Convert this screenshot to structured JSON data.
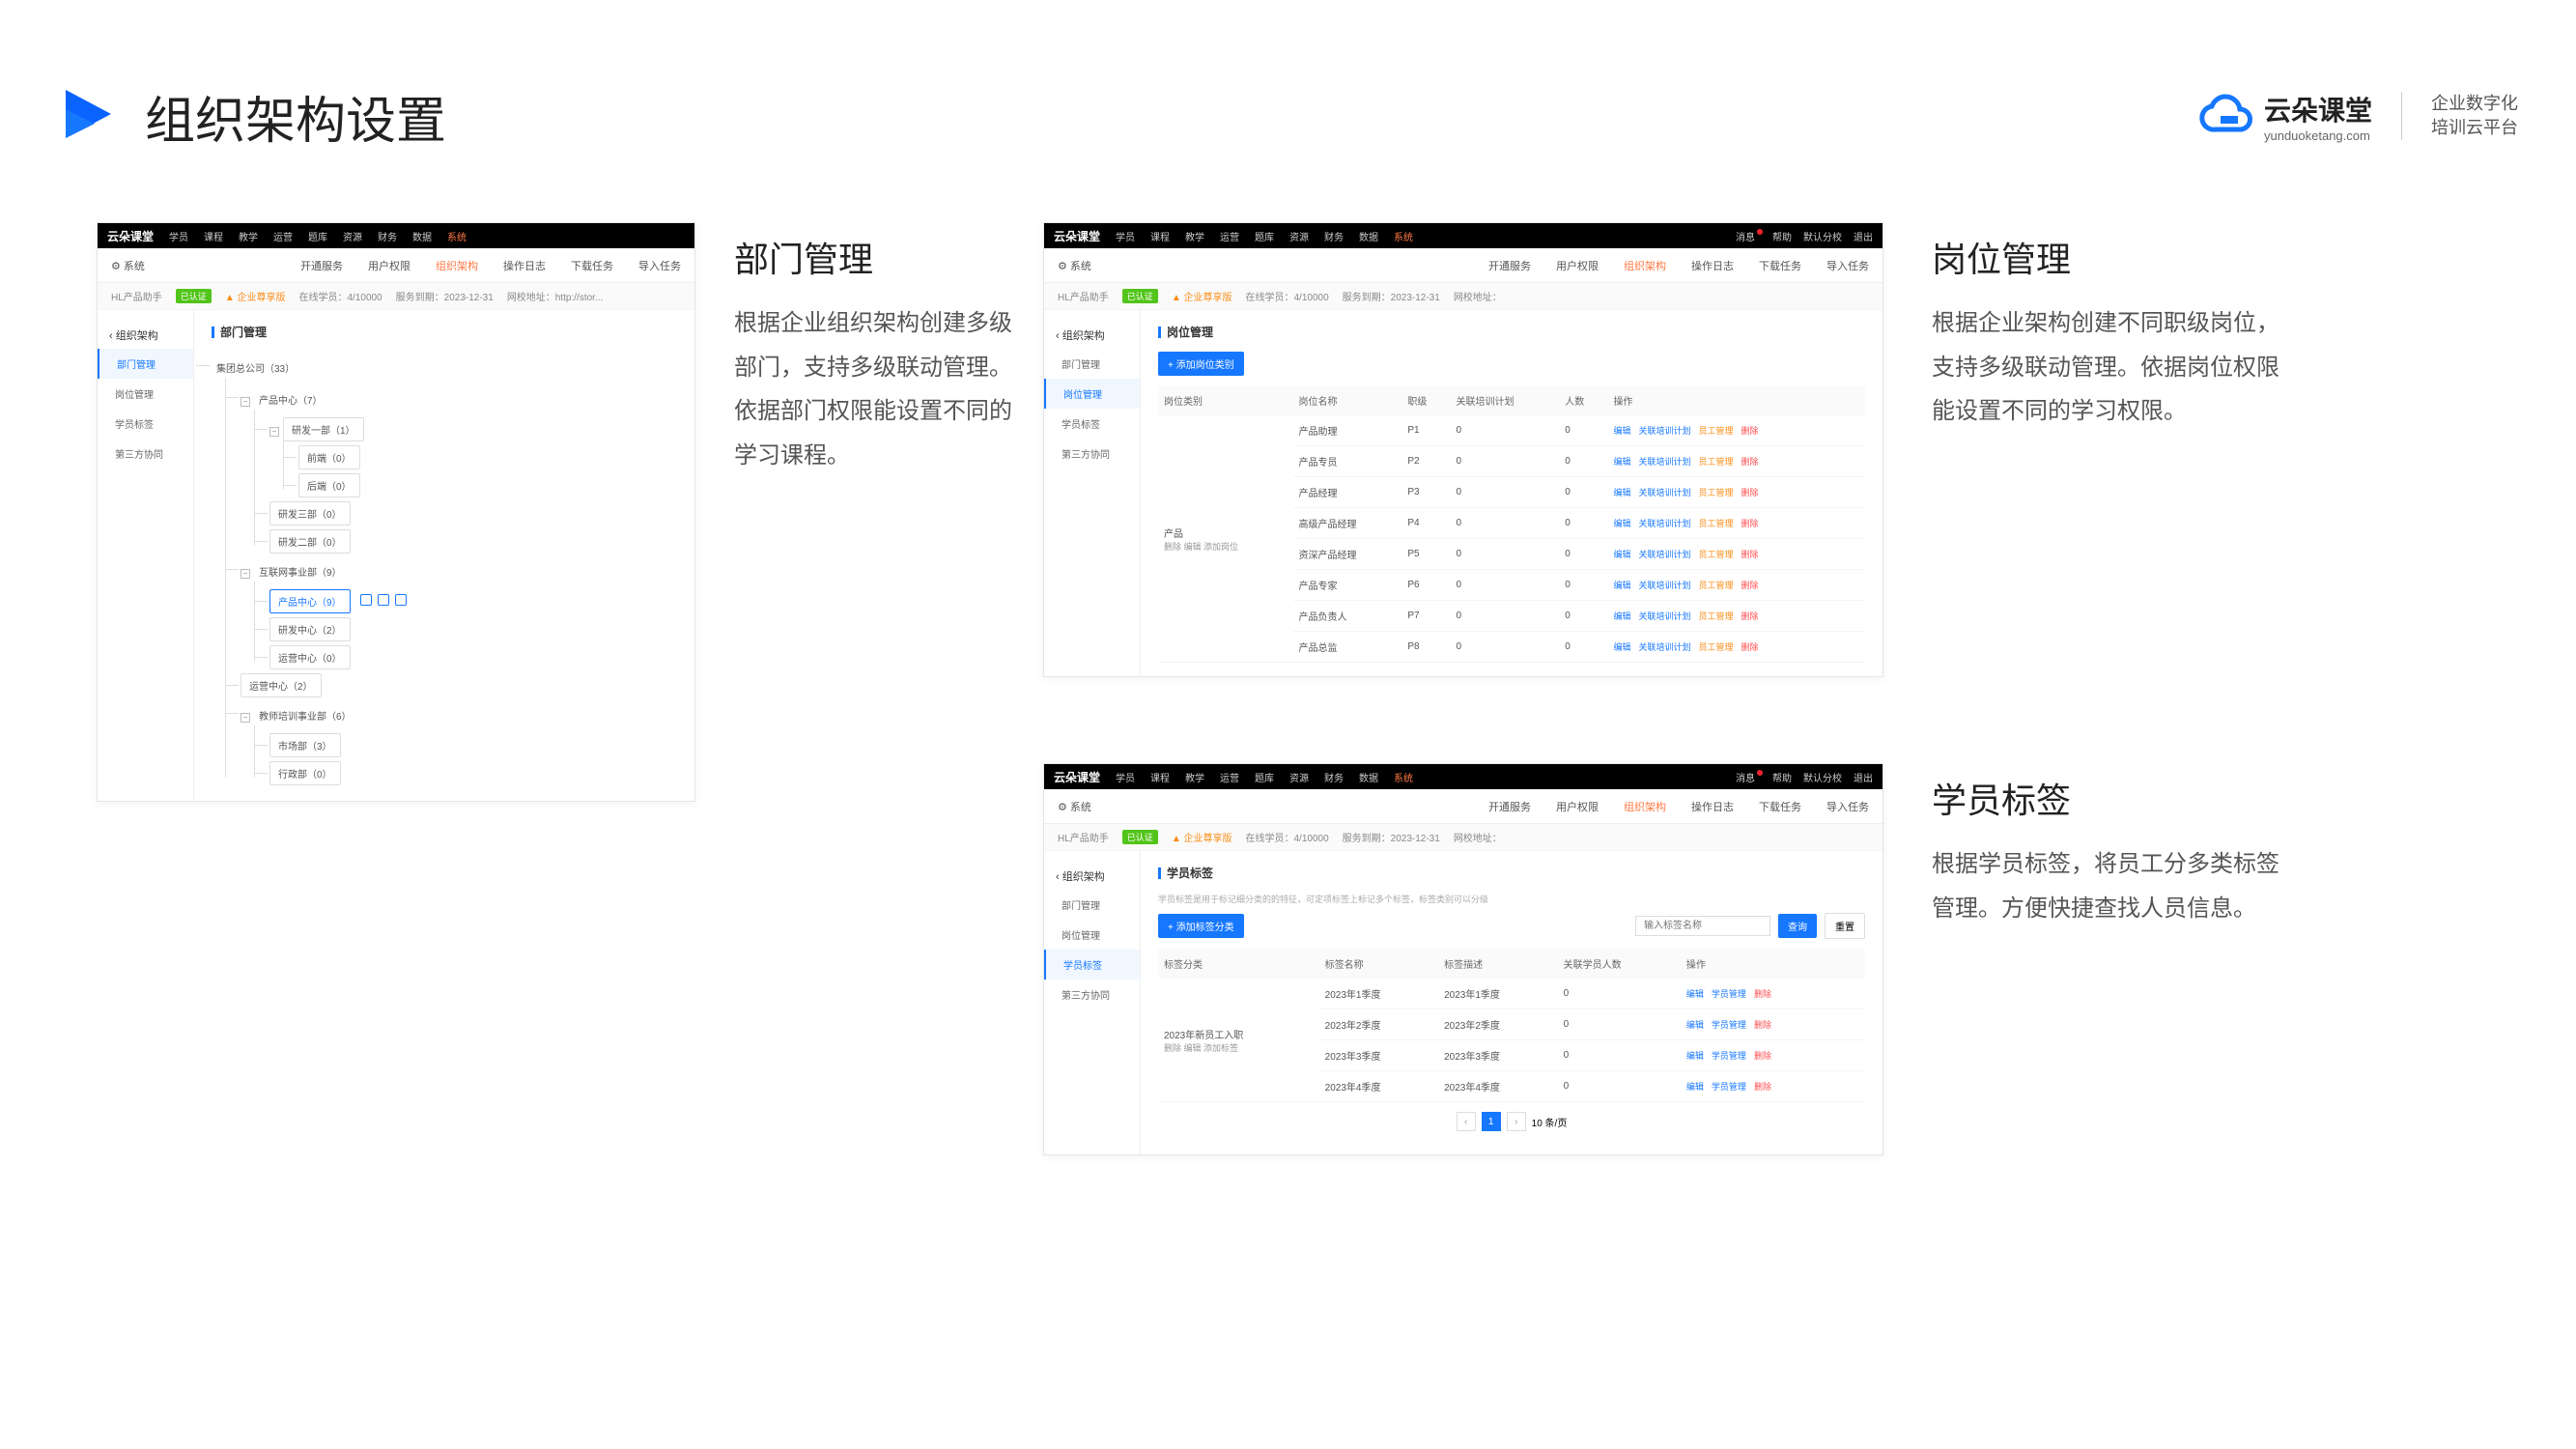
{
  "header": {
    "title": "组织架构设置",
    "logo_cn": "云朵课堂",
    "logo_en": "yunduoketang.com",
    "tagline_line1": "企业数字化",
    "tagline_line2": "培训云平台"
  },
  "sections": {
    "dept": {
      "title": "部门管理",
      "desc": "根据企业组织架构创建多级部门，支持多级联动管理。依据部门权限能设置不同的学习课程。"
    },
    "position": {
      "title": "岗位管理",
      "desc": "根据企业架构创建不同职级岗位，支持多级联动管理。依据岗位权限能设置不同的学习权限。"
    },
    "tag": {
      "title": "学员标签",
      "desc": "根据学员标签，将员工分多类标签管理。方便快捷查找人员信息。"
    }
  },
  "app_common": {
    "brand": "云朵课堂",
    "top_nav": [
      "学员",
      "课程",
      "教学",
      "运营",
      "题库",
      "资源",
      "财务",
      "数据",
      "系统"
    ],
    "top_nav_active": "系统",
    "msg": "消息",
    "help": "帮助",
    "branch": "默认分校",
    "logout": "退出",
    "gear_label": "系统",
    "sub_nav": [
      "开通服务",
      "用户权限",
      "组织架构",
      "操作日志",
      "下载任务",
      "导入任务"
    ],
    "sub_nav_active": "组织架构",
    "tenant": "HL产品助手",
    "cert": "已认证",
    "plan": "企业尊享版",
    "online": "在线学员：4/10000",
    "expiry": "服务到期：2023-12-31",
    "site": "网校地址：http://stor...",
    "site_short": "网校地址：",
    "sidebar_title": "组织架构",
    "sidebar_items": [
      "部门管理",
      "岗位管理",
      "学员标签",
      "第三方协同"
    ]
  },
  "panel_dept": {
    "main_title": "部门管理",
    "tree": {
      "root": "集团总公司（33）",
      "c1": {
        "name": "产品中心（7）",
        "children": [
          {
            "name": "研发一部（1）",
            "children": [
              {
                "name": "前端（0）"
              },
              {
                "name": "后端（0）"
              }
            ]
          },
          {
            "name": "研发三部（0）"
          },
          {
            "name": "研发二部（0）"
          }
        ]
      },
      "c2": {
        "name": "互联网事业部（9）",
        "children": [
          {
            "name": "产品中心（9）",
            "selected": true,
            "icons": true
          },
          {
            "name": "研发中心（2）"
          },
          {
            "name": "运营中心（0）"
          }
        ]
      },
      "c3": {
        "name": "运营中心（2）"
      },
      "c4": {
        "name": "教师培训事业部（6）",
        "children": [
          {
            "name": "市场部（3）"
          },
          {
            "name": "行政部（0）"
          }
        ]
      }
    }
  },
  "panel_position": {
    "main_title": "岗位管理",
    "add_btn": "+ 添加岗位类别",
    "columns": [
      "岗位类别",
      "岗位名称",
      "职级",
      "关联培训计划",
      "人数",
      "操作"
    ],
    "group": {
      "name": "产品",
      "actions": "删除 编辑 添加岗位"
    },
    "rows": [
      {
        "name": "产品助理",
        "level": "P1",
        "plan": 0,
        "count": 0
      },
      {
        "name": "产品专员",
        "level": "P2",
        "plan": 0,
        "count": 0
      },
      {
        "name": "产品经理",
        "level": "P3",
        "plan": 0,
        "count": 0
      },
      {
        "name": "高级产品经理",
        "level": "P4",
        "plan": 0,
        "count": 0
      },
      {
        "name": "资深产品经理",
        "level": "P5",
        "plan": 0,
        "count": 0
      },
      {
        "name": "产品专家",
        "level": "P6",
        "plan": 0,
        "count": 0
      },
      {
        "name": "产品负责人",
        "level": "P7",
        "plan": 0,
        "count": 0
      },
      {
        "name": "产品总监",
        "level": "P8",
        "plan": 0,
        "count": 0
      }
    ],
    "row_actions": {
      "edit": "编辑",
      "plan": "关联培训计划",
      "mgr": "员工管理",
      "del": "删除"
    }
  },
  "panel_tag": {
    "main_title": "学员标签",
    "tip": "学员标签是用于标记细分类的的特征，可定项标签上标记多个标签，标签类别可以分级",
    "add_btn": "+ 添加标签分类",
    "search_placeholder": "输入标签名称",
    "search_btn": "查询",
    "reset_btn": "重置",
    "columns": [
      "标签分类",
      "标签名称",
      "标签描述",
      "关联学员人数",
      "操作"
    ],
    "group": {
      "name": "2023年新员工入职",
      "actions": "删除 编辑 添加标签"
    },
    "rows": [
      {
        "name": "2023年1季度",
        "desc": "2023年1季度",
        "count": 0
      },
      {
        "name": "2023年2季度",
        "desc": "2023年2季度",
        "count": 0
      },
      {
        "name": "2023年3季度",
        "desc": "2023年3季度",
        "count": 0
      },
      {
        "name": "2023年4季度",
        "desc": "2023年4季度",
        "count": 0
      }
    ],
    "row_actions": {
      "edit": "编辑",
      "mgr": "学员管理",
      "del": "删除"
    },
    "pager": {
      "page": "1",
      "per": "10 条/页"
    }
  }
}
